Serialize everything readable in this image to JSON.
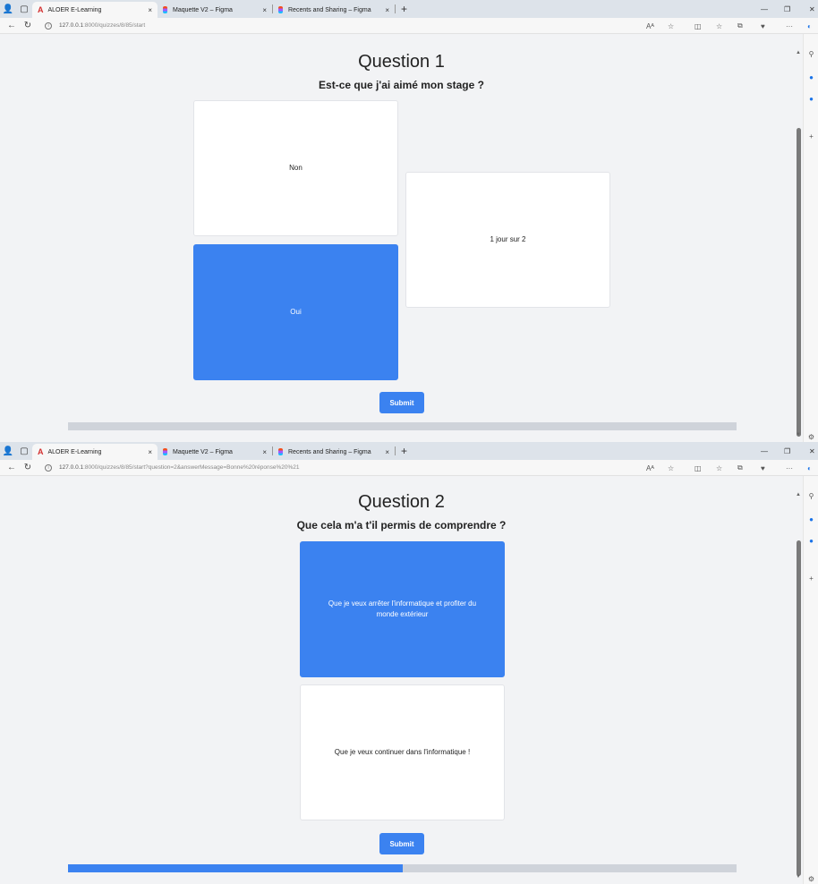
{
  "browser": {
    "tabs": [
      {
        "label": "ALOER E-Learning",
        "favicon": "aloer-logo-icon",
        "active": true
      },
      {
        "label": "Maquette V2 – Figma",
        "favicon": "figma-icon",
        "active": false
      },
      {
        "label": "Recents and Sharing – Figma",
        "favicon": "figma-icon",
        "active": false
      }
    ],
    "new_tab": "+",
    "close_glyph": "×",
    "reader_glyph": "Aᴬ"
  },
  "screens": [
    {
      "url_host": "127.0.0.1",
      "url_path": ":8000/quizzes/8/85/start",
      "question_title": "Question 1",
      "question_text": "Est-ce que j'ai aimé mon stage ?",
      "answers": [
        {
          "label": "Non",
          "selected": false
        },
        {
          "label": "Oui",
          "selected": true
        },
        {
          "label": "1 jour sur 2",
          "selected": false
        }
      ],
      "submit_label": "Submit",
      "progress_fraction": 0.0
    },
    {
      "url_host": "127.0.0.1",
      "url_path": ":8000/quizzes/8/85/start?question=2&answerMessage=Bonne%20réponse%20%21",
      "question_title": "Question 2",
      "question_text": "Que cela m'a t'il permis de comprendre ?",
      "answers": [
        {
          "label": "Que je veux arrêter l'informatique et profiter du monde extérieur",
          "selected": true
        },
        {
          "label": "Que je veux continuer dans l'informatique !",
          "selected": false
        }
      ],
      "submit_label": "Submit",
      "progress_fraction": 0.5
    }
  ],
  "colors": {
    "accent": "#3b82f0",
    "page_bg": "#f2f3f5",
    "progress_track": "#cfd3da"
  }
}
